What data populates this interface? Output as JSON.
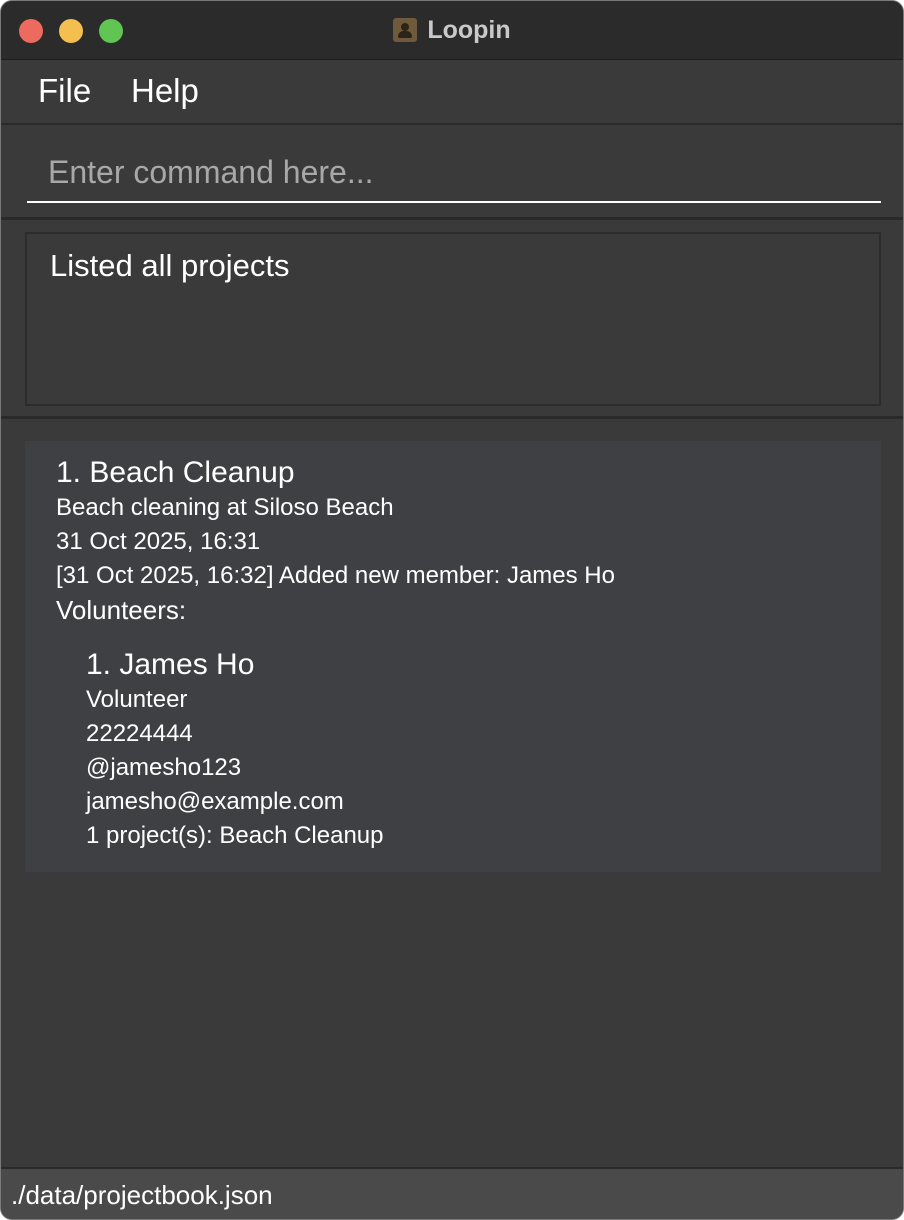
{
  "window": {
    "title": "Loopin",
    "icon": "contact-book-icon"
  },
  "menu": {
    "items": [
      "File",
      "Help"
    ]
  },
  "command": {
    "placeholder": "Enter command here...",
    "value": ""
  },
  "result": {
    "message": "Listed all projects"
  },
  "projects": [
    {
      "index_title": "1. Beach Cleanup",
      "description": "Beach cleaning at Siloso Beach",
      "datetime": "31 Oct 2025, 16:31",
      "log": "[31 Oct 2025, 16:32] Added new member: James Ho",
      "volunteers_label": "Volunteers:",
      "volunteers": [
        {
          "index_name": "1. James Ho",
          "role": "Volunteer",
          "phone": "22224444",
          "telegram": "@jamesho123",
          "email": "jamesho@example.com",
          "projects": "1 project(s): Beach Cleanup"
        }
      ]
    }
  ],
  "status": {
    "file_path": "./data/projectbook.json"
  },
  "colors": {
    "window_bg": "#3a3a3a",
    "titlebar_bg": "#2b2b2b",
    "card_bg": "#3f4043",
    "status_bg": "#4a4a4a",
    "close_light": "#ed6a5e",
    "minimize_light": "#f5bf4f",
    "maximize_light": "#61c554"
  }
}
